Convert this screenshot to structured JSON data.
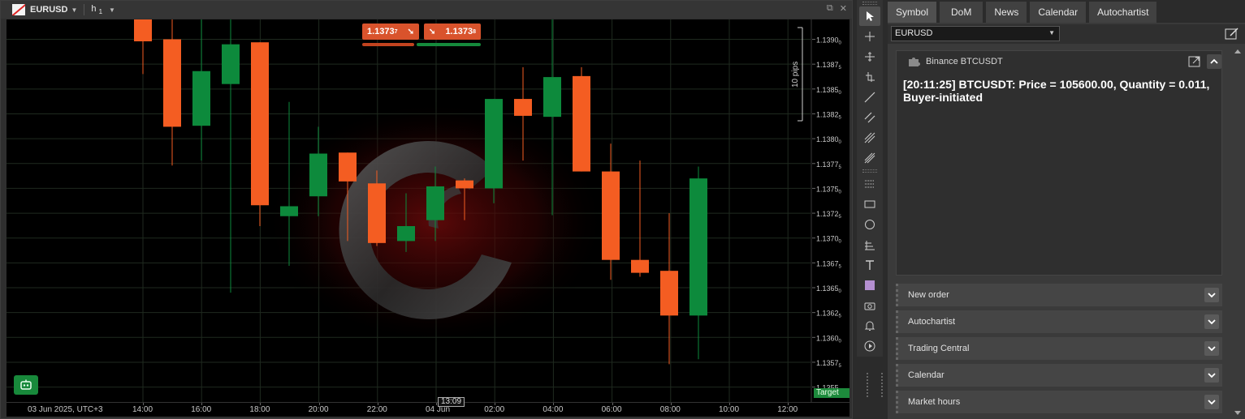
{
  "chart": {
    "symbol": "EURUSD",
    "timeframe": "h",
    "timeframe_sub": "1",
    "bid_price_main": "1.1373",
    "bid_price_pip": "7",
    "ask_price_main": "1.1373",
    "ask_price_pip": "8",
    "pips_label": "10 pips",
    "current_time": "13:09",
    "target_label": "Target",
    "colors": {
      "bull": "#0d8a3c",
      "bear": "#f45d22",
      "grid": "#1f2a1f",
      "background": "#000000"
    }
  },
  "chart_data": {
    "type": "candlestick",
    "ylim": [
      1.13535,
      1.1392
    ],
    "y_ticks": [
      "1.1390",
      "1.1387",
      "1.1385",
      "1.1382",
      "1.1380",
      "1.1377",
      "1.1375",
      "1.1372",
      "1.1370",
      "1.1367",
      "1.1365",
      "1.1362",
      "1.1360",
      "1.1357",
      "1.1355"
    ],
    "y_tick_subs": [
      "0",
      "5",
      "0",
      "5",
      "0",
      "5",
      "0",
      "5",
      "0",
      "5",
      "0",
      "5",
      "0",
      "5",
      "0"
    ],
    "x_ticks": [
      "03 Jun 2025, UTC+3",
      "14:00",
      "16:00",
      "18:00",
      "20:00",
      "22:00",
      "04 Jun",
      "02:00",
      "04:00",
      "06:00",
      "08:00",
      "10:00",
      "12:00"
    ],
    "candles": [
      {
        "o": 1.1392,
        "h": 1.1392,
        "l": 1.13865,
        "c": 1.13898
      },
      {
        "o": 1.139,
        "h": 1.1392,
        "l": 1.13773,
        "c": 1.13812
      },
      {
        "o": 1.13813,
        "h": 1.1392,
        "l": 1.13778,
        "c": 1.13868
      },
      {
        "o": 1.13855,
        "h": 1.1392,
        "l": 1.13645,
        "c": 1.13895
      },
      {
        "o": 1.13897,
        "h": 1.13897,
        "l": 1.13712,
        "c": 1.13733
      },
      {
        "o": 1.13722,
        "h": 1.13837,
        "l": 1.13672,
        "c": 1.13732
      },
      {
        "o": 1.13742,
        "h": 1.13812,
        "l": 1.13722,
        "c": 1.13785
      },
      {
        "o": 1.13786,
        "h": 1.13786,
        "l": 1.13697,
        "c": 1.13757
      },
      {
        "o": 1.13755,
        "h": 1.13768,
        "l": 1.13692,
        "c": 1.13695
      },
      {
        "o": 1.13697,
        "h": 1.13745,
        "l": 1.13686,
        "c": 1.13712
      },
      {
        "o": 1.13718,
        "h": 1.13772,
        "l": 1.13697,
        "c": 1.13752
      },
      {
        "o": 1.13758,
        "h": 1.1376,
        "l": 1.13718,
        "c": 1.1375
      },
      {
        "o": 1.1375,
        "h": 1.1384,
        "l": 1.13735,
        "c": 1.1384
      },
      {
        "o": 1.1384,
        "h": 1.13872,
        "l": 1.13778,
        "c": 1.13823
      },
      {
        "o": 1.13822,
        "h": 1.1392,
        "l": 1.13723,
        "c": 1.13862
      },
      {
        "o": 1.13863,
        "h": 1.13872,
        "l": 1.13767,
        "c": 1.13767
      },
      {
        "o": 1.13767,
        "h": 1.13795,
        "l": 1.13658,
        "c": 1.13678
      },
      {
        "o": 1.13678,
        "h": 1.13778,
        "l": 1.13661,
        "c": 1.13665
      },
      {
        "o": 1.13667,
        "h": 1.13725,
        "l": 1.13573,
        "c": 1.13622
      },
      {
        "o": 1.13622,
        "h": 1.13772,
        "l": 1.13578,
        "c": 1.1376
      }
    ]
  },
  "toolbar": {
    "tools": [
      "cursor-icon",
      "crosshair-icon",
      "zoom-icon",
      "anchor-icon",
      "trendline-icon",
      "channel-icon",
      "fibonacci-icon",
      "pitchfork-icon",
      "levels-icon",
      "rectangle-icon",
      "ellipse-icon",
      "fan-icon",
      "text-icon",
      "color-swatch-icon",
      "camera-icon",
      "bell-icon",
      "replay-icon"
    ]
  },
  "panel": {
    "tabs": [
      "Symbol",
      "DoM",
      "News",
      "Calendar",
      "Autochartist"
    ],
    "symbol_value": "EURUSD",
    "cbot": {
      "title": "Binance BTCUSDT",
      "message": "[20:11:25] BTCUSDT: Price = 105600.00, Quantity = 0.011, Buyer-initiated"
    },
    "sections": [
      "New order",
      "Autochartist",
      "Trading Central",
      "Calendar",
      "Market hours"
    ]
  }
}
